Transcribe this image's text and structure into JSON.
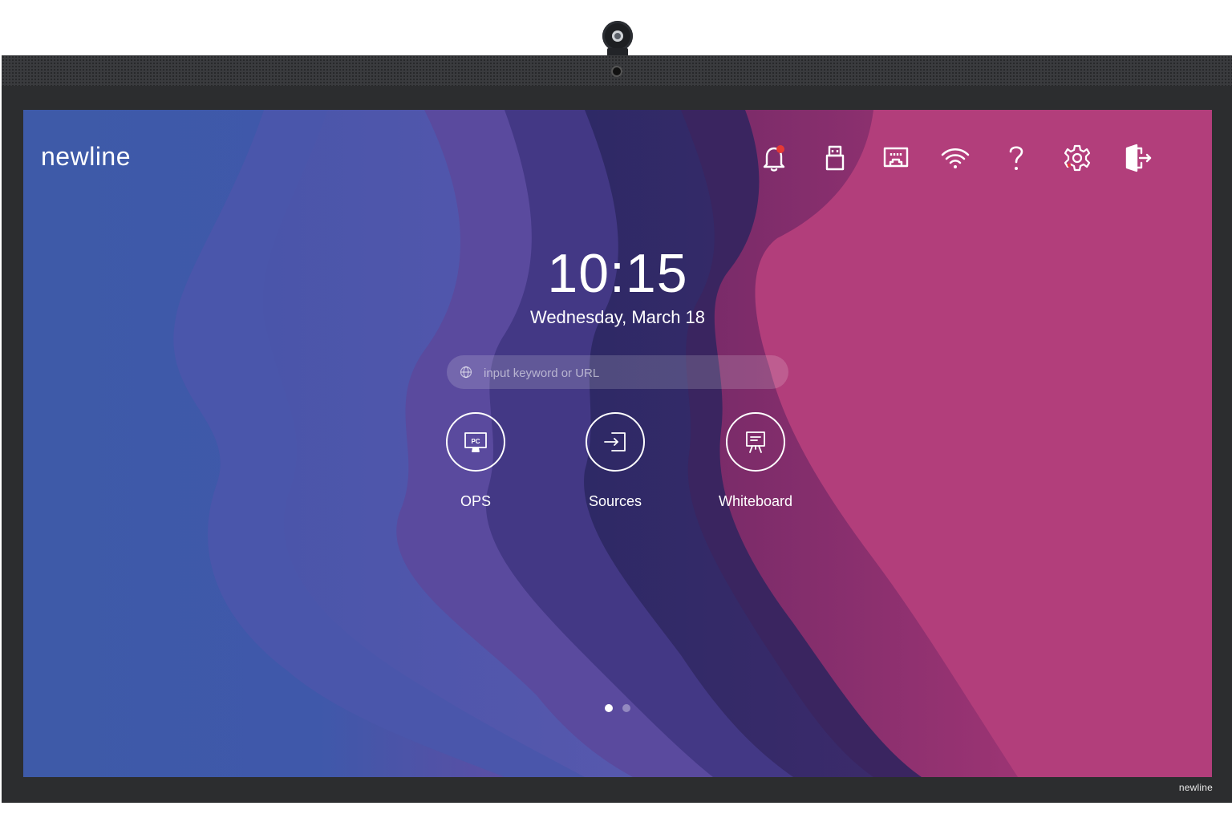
{
  "brand": {
    "name": "newline",
    "bezel_logo": "newline"
  },
  "status_bar": {
    "icons": [
      {
        "name": "notification-bell-icon",
        "badge_color": "#e53935"
      },
      {
        "name": "usb-icon"
      },
      {
        "name": "ethernet-icon"
      },
      {
        "name": "wifi-icon"
      },
      {
        "name": "help-icon"
      },
      {
        "name": "settings-gear-icon"
      },
      {
        "name": "exit-icon"
      }
    ]
  },
  "clock": {
    "time": "10:15",
    "date": "Wednesday, March 18"
  },
  "search": {
    "placeholder": "input keyword or URL",
    "value": ""
  },
  "apps": [
    {
      "label": "OPS",
      "icon": "pc-monitor-icon"
    },
    {
      "label": "Sources",
      "icon": "input-source-icon"
    },
    {
      "label": "Whiteboard",
      "icon": "whiteboard-icon"
    }
  ],
  "pager": {
    "pages": 2,
    "active": 1
  },
  "colors": {
    "left_bg": "#3e5aa8",
    "right_bg": "#b2407c",
    "frame": "#2c2d2f"
  }
}
